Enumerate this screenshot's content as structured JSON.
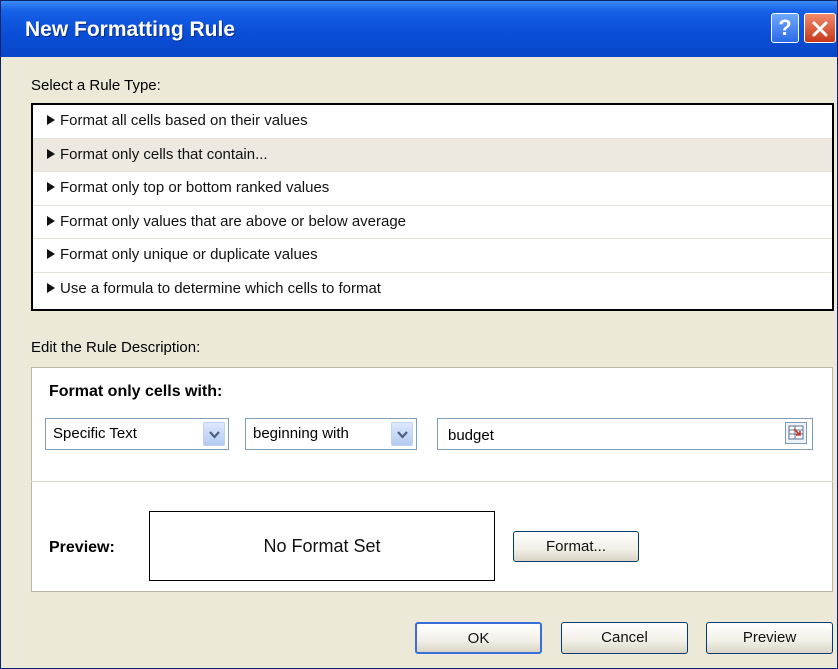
{
  "dialog": {
    "title": "New Formatting Rule",
    "help_glyph": "?"
  },
  "rule_type": {
    "label": "Select a Rule Type:",
    "items": [
      "Format all cells based on their values",
      "Format only cells that contain...",
      "Format only top or bottom ranked values",
      "Format only values that are above or below average",
      "Format only unique or duplicate values",
      "Use a formula to determine which cells to format"
    ],
    "selected_index": 1
  },
  "description": {
    "label": "Edit the Rule Description:",
    "heading": "Format only cells with:",
    "condition_type": "Specific Text",
    "operator": "beginning with",
    "value": "budget",
    "preview_label": "Preview:",
    "preview_text": "No Format Set",
    "format_button": "Format..."
  },
  "buttons": {
    "ok": "OK",
    "cancel": "Cancel",
    "preview": "Preview"
  },
  "colors": {
    "titlebar": "#0a4fd8",
    "dialog_bg": "#ece9d8",
    "close_button": "#c7381c"
  }
}
